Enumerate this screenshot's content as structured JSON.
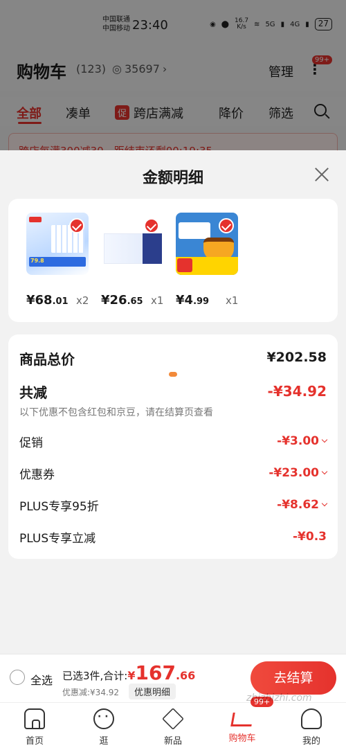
{
  "status_bar": {
    "carrier_1": "中国联通",
    "carrier_2": "中国移动",
    "time": "23:40",
    "speed_value": "16.7",
    "speed_unit": "K/s",
    "net_1": "5G",
    "net_2": "4G",
    "battery": "27"
  },
  "header": {
    "title": "购物车",
    "count": "(123)",
    "views": "35697",
    "manage": "管理",
    "badge": "99+"
  },
  "tabs": [
    {
      "label": "全部",
      "active": true
    },
    {
      "label": "凑单"
    },
    {
      "label": "跨店满减",
      "tag": "促"
    },
    {
      "label": "降价"
    },
    {
      "label": "筛选"
    }
  ],
  "banner": "跨店每满300减30，距结束还剩00:19:35",
  "sheet": {
    "title": "金额明细",
    "products": [
      {
        "price_int": "¥68",
        "price_dec": ".01",
        "qty": "x2",
        "img_text": "79.8"
      },
      {
        "price_int": "¥26",
        "price_dec": ".65",
        "qty": "x1"
      },
      {
        "price_int": "¥4",
        "price_dec": ".99",
        "qty": "x1"
      }
    ],
    "total_label": "商品总价",
    "total_value": "¥202.58",
    "reduce_label": "共减",
    "reduce_value": "-¥34.92",
    "reduce_note": "以下优惠不包含红包和京豆，请在结算页查看",
    "rows": [
      {
        "label": "促销",
        "value": "-¥3.00"
      },
      {
        "label": "优惠券",
        "value": "-¥23.00"
      },
      {
        "label": "PLUS专享95折",
        "value": "-¥8.62"
      },
      {
        "label": "PLUS专享立减",
        "value": "-¥0.3"
      }
    ]
  },
  "checkout": {
    "select_all": "全选",
    "summary_prefix": "已选3件,合计:",
    "total_symbol": "¥",
    "total_int": "167",
    "total_dec": ".66",
    "discount": "优惠减:¥34.92",
    "detail_link": "优惠明细",
    "button": "去结算"
  },
  "tabbar": {
    "items": [
      {
        "label": "首页",
        "icon": "home-icon"
      },
      {
        "label": "逛",
        "icon": "stroll-icon"
      },
      {
        "label": "新品",
        "icon": "new-products-icon"
      },
      {
        "label": "购物车",
        "icon": "cart-icon",
        "active": true
      },
      {
        "label": "我的",
        "icon": "user-icon"
      }
    ],
    "cart_badge": "99+"
  },
  "watermark": "zhizhizhi.com",
  "colors": {
    "accent": "#e5322d",
    "background": "#f2f2f2"
  }
}
